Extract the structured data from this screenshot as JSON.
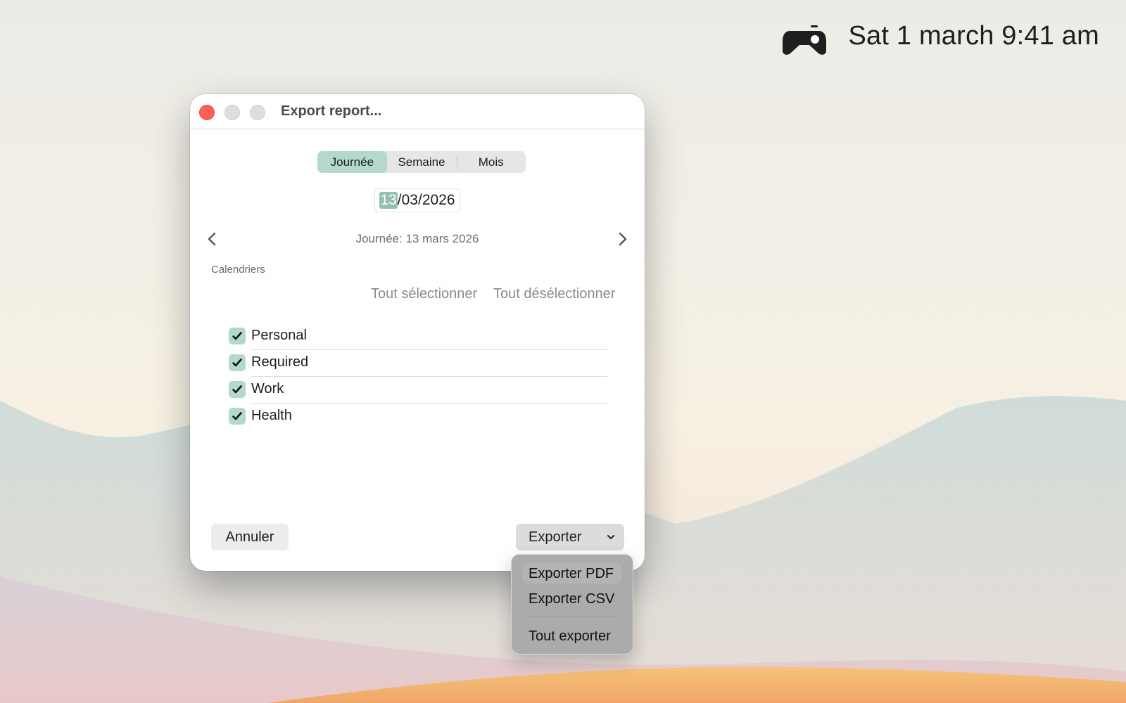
{
  "menubar": {
    "app_icon": "game-controller-icon",
    "clock": "Sat 1 march 9:41 am"
  },
  "window": {
    "title": "Export report...",
    "controls": [
      "close-icon",
      "minimize-icon",
      "zoom-icon"
    ]
  },
  "period_tabs": [
    {
      "label": "Journée",
      "selected": true
    },
    {
      "label": "Semaine",
      "selected": false
    },
    {
      "label": "Mois",
      "selected": false
    }
  ],
  "date_field": {
    "day": "13",
    "rest": "/03/2026"
  },
  "navigation": {
    "prev_icon": "chevron-left-icon",
    "next_icon": "chevron-right-icon",
    "label": "Journée: 13 mars 2026"
  },
  "calendars": {
    "section_label": "Calendriers",
    "select_all": "Tout sélectionner",
    "deselect_all": "Tout désélectionner",
    "items": [
      {
        "label": "Personal",
        "checked": true
      },
      {
        "label": "Required",
        "checked": true
      },
      {
        "label": "Work",
        "checked": true
      },
      {
        "label": "Health",
        "checked": true
      }
    ]
  },
  "buttons": {
    "cancel": "Annuler",
    "export": "Exporter"
  },
  "export_menu": {
    "items": [
      "Exporter PDF",
      "Exporter CSV",
      "Tout exporter"
    ]
  },
  "colors": {
    "accent": "#b2d9cc",
    "close": "#fe5f57"
  }
}
